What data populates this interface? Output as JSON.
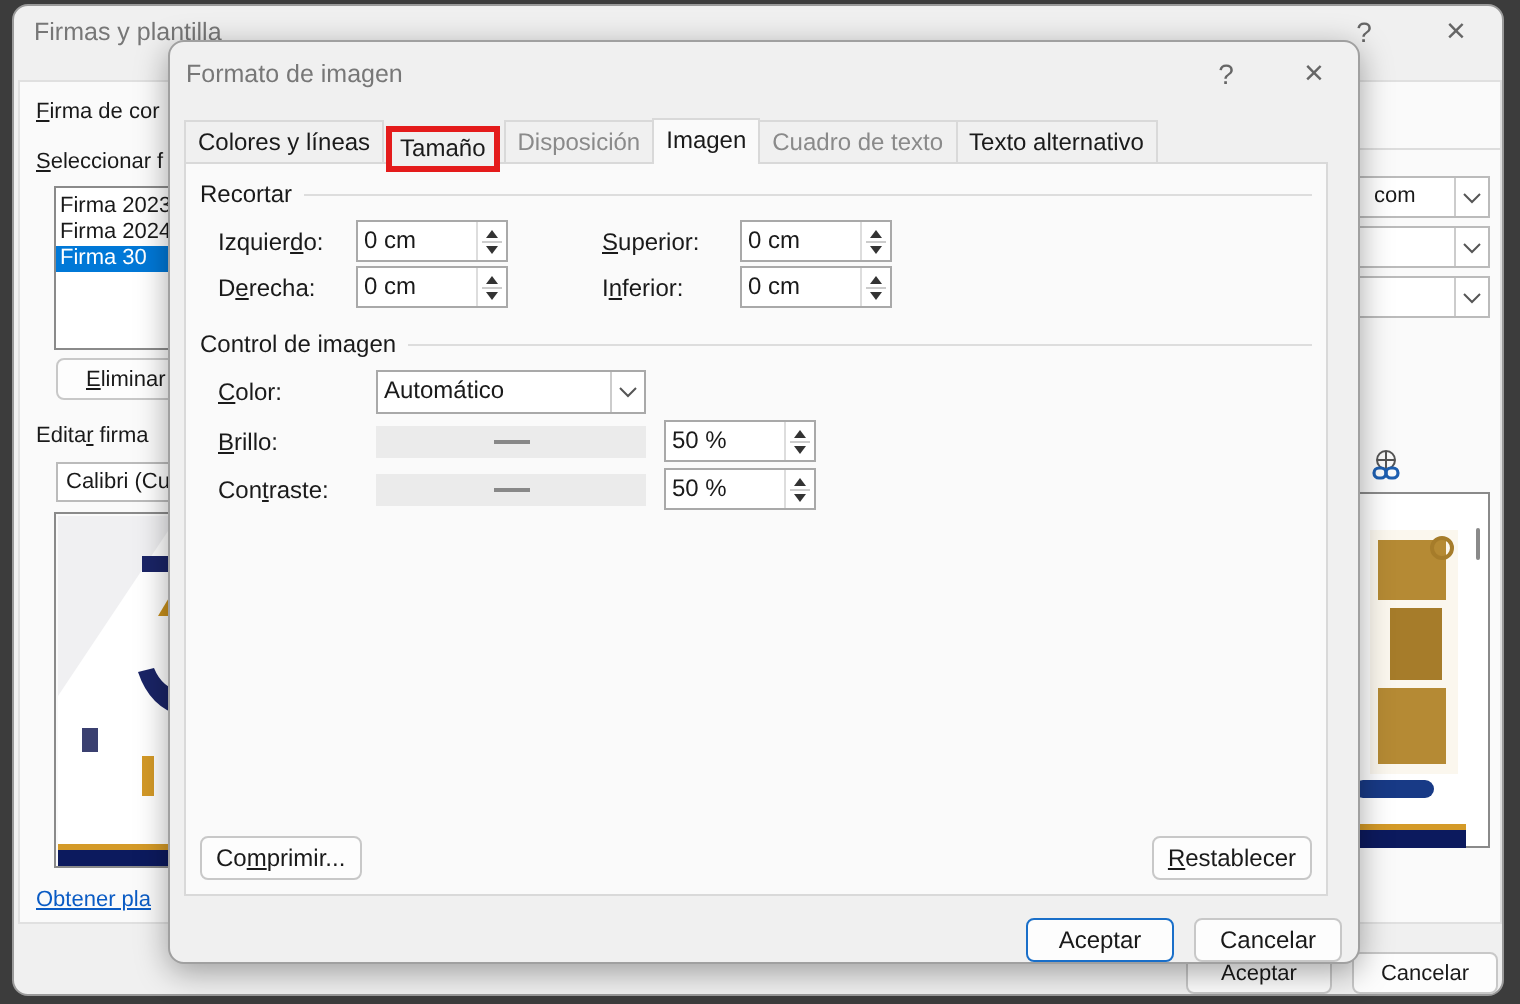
{
  "background_window": {
    "title": "Firmas y plantilla",
    "help": "?",
    "close": "×",
    "section_label": {
      "key": "F",
      "post": "irma de cor"
    },
    "select_label": {
      "key": "S",
      "post": "eleccionar f"
    },
    "signatures": [
      {
        "name": "Firma 2023",
        "selected": false
      },
      {
        "name": "Firma 2024",
        "selected": false
      },
      {
        "name": "Firma 30",
        "selected": true
      }
    ],
    "delete_button": {
      "key": "E",
      "post": "liminar"
    },
    "edit_label": {
      "pre": "Edita",
      "key": "r",
      "post": " firma"
    },
    "font": "Calibri (Cu",
    "account": "com",
    "link": "Obtener pla",
    "buttons": [
      "Aceptar",
      "Cancelar"
    ]
  },
  "dialog": {
    "title": "Formato de imagen",
    "help": "?",
    "close": "×",
    "tabs": [
      {
        "label": "Colores y líneas",
        "selected": false,
        "disabled": false,
        "highlighted": false
      },
      {
        "label": "Tamaño",
        "selected": false,
        "disabled": false,
        "highlighted": true
      },
      {
        "label": "Disposición",
        "selected": false,
        "disabled": true,
        "highlighted": false
      },
      {
        "label": "Imagen",
        "selected": true,
        "disabled": false,
        "highlighted": false
      },
      {
        "label": "Cuadro de texto",
        "selected": false,
        "disabled": true,
        "highlighted": false
      },
      {
        "label": "Texto alternativo",
        "selected": false,
        "disabled": false,
        "highlighted": false
      }
    ],
    "crop": {
      "title": "Recortar",
      "fields": [
        {
          "label": {
            "pre": "Izquier",
            "key": "d",
            "post": "o:"
          },
          "value": "0 cm"
        },
        {
          "label": {
            "key": "S",
            "post": "uperior:"
          },
          "value": "0 cm"
        },
        {
          "label": {
            "pre": "D",
            "key": "e",
            "post": "recha:"
          },
          "value": "0 cm"
        },
        {
          "label": {
            "pre": "I",
            "key": "n",
            "post": "ferior:"
          },
          "value": "0 cm"
        }
      ]
    },
    "image_control": {
      "title": "Control de imagen",
      "color": {
        "label": {
          "key": "C",
          "post": "olor:"
        },
        "value": "Automático"
      },
      "sliders": [
        {
          "label": {
            "key": "B",
            "post": "rillo:"
          },
          "level": 0.5,
          "disabled": true,
          "value": "50 %"
        },
        {
          "label": {
            "pre": "Con",
            "key": "t",
            "post": "raste:"
          },
          "level": 0.5,
          "disabled": true,
          "value": "50 %"
        }
      ]
    },
    "compress_button": {
      "pre": "Co",
      "key": "m",
      "post": "primir..."
    },
    "reset_button": {
      "key": "R",
      "post": "establecer"
    },
    "buttons": [
      {
        "label": "Aceptar",
        "default": true
      },
      {
        "label": "Cancelar",
        "default": false
      }
    ]
  }
}
